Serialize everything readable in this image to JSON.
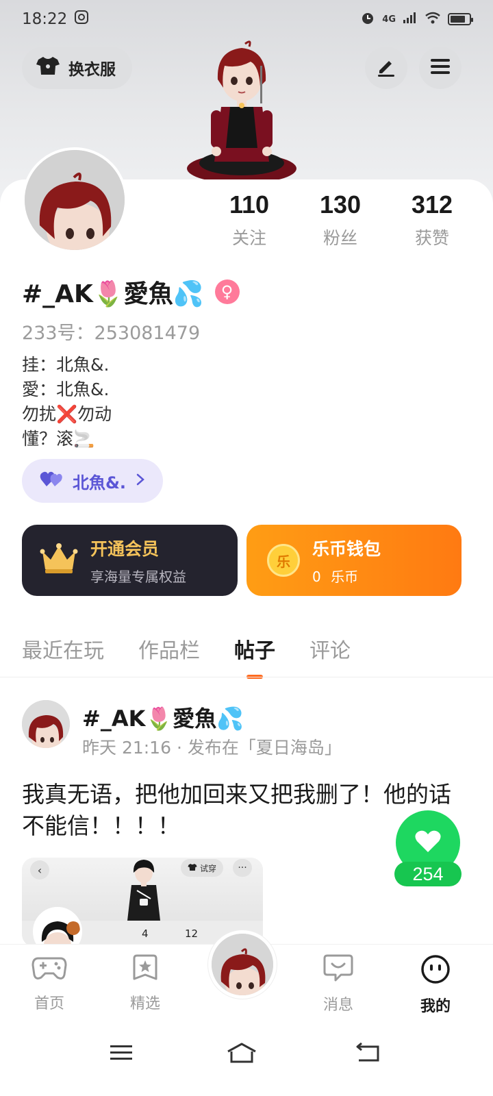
{
  "status_bar": {
    "time": "18:22",
    "network": "4G",
    "battery_level": 0.8
  },
  "header": {
    "dress_up_label": "换衣服",
    "edit_icon": "edit-icon",
    "menu_icon": "menu-icon"
  },
  "profile": {
    "stats": [
      {
        "value": "110",
        "label": "关注"
      },
      {
        "value": "130",
        "label": "粉丝"
      },
      {
        "value": "312",
        "label": "获赞"
      }
    ],
    "nickname": "#_AK🌷愛魚💦",
    "gender_symbol": "♀",
    "uid": "233号：253081479",
    "bio_lines": [
      "挂：北魚&.",
      "愛：北魚&.",
      "勿扰❌勿动",
      "懂？滚🚬"
    ],
    "couple_label": "北魚&."
  },
  "cards": {
    "vip_title": "开通会员",
    "vip_subtitle": "享海量专属权益",
    "wallet_title": "乐币钱包",
    "wallet_balance": "0",
    "wallet_unit": "乐币",
    "wallet_coin_glyph": "乐"
  },
  "tabs": [
    {
      "label": "最近在玩",
      "active": false
    },
    {
      "label": "作品栏",
      "active": false
    },
    {
      "label": "帖子",
      "active": true
    },
    {
      "label": "评论",
      "active": false
    }
  ],
  "post": {
    "author": "#_AK🌷愛魚💦",
    "meta": "昨天  21:16 · 发布在「夏日海岛」",
    "text": "我真无语，把他加回来又把我删了！他的话不能信！！！！",
    "thumb_try": "试穿",
    "thumb_count_a": "4",
    "thumb_count_b": "12",
    "likes": "254"
  },
  "bottom_nav": [
    {
      "label": "首页",
      "icon": "gamepad-icon",
      "active": false
    },
    {
      "label": "精选",
      "icon": "star-badge-icon",
      "active": false
    },
    {
      "label": "消息",
      "icon": "chat-bubble-icon",
      "active": false
    },
    {
      "label": "我的",
      "icon": "smiley-face-icon",
      "active": true
    }
  ],
  "colors": {
    "accent_orange": "#ff6a1f",
    "like_green": "#1ed760",
    "couple_purple": "#5b56d6",
    "vip_gold": "#f5c35a"
  }
}
